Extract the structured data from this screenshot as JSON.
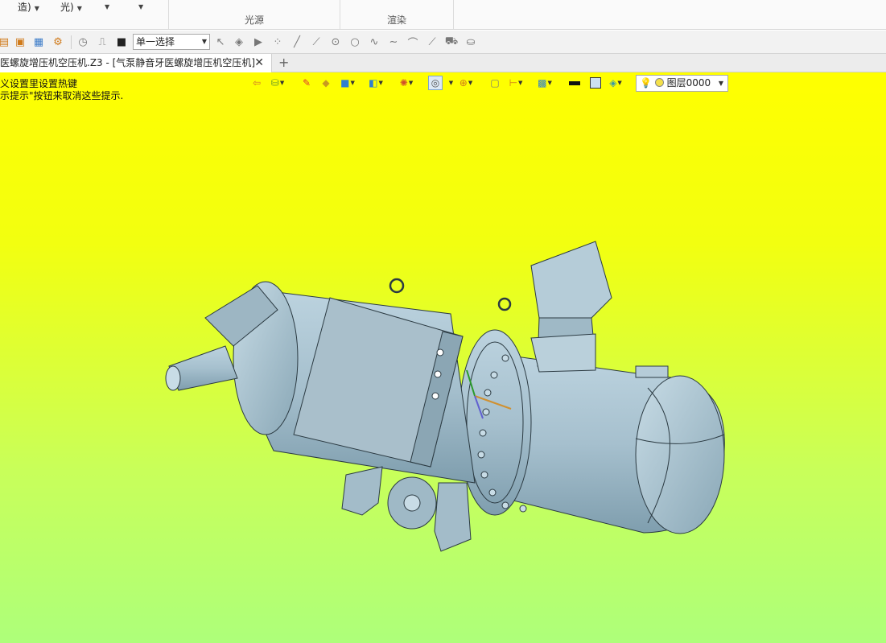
{
  "ribbon": {
    "dropdown1_label": "造)",
    "dropdown2_label": "光)",
    "group_light_label": "光源",
    "group_render_label": "渲染"
  },
  "toolbar": {
    "select_mode_value": "单一选择"
  },
  "tabs": {
    "document_tab_label": "医螺旋增压机空压机.Z3 - [气泵静音牙医螺旋增压机空压机]",
    "close_glyph": "✕",
    "add_glyph": "+"
  },
  "viewport": {
    "hint_line1": "义设置里设置热键",
    "hint_line2": "示提示\"按钮来取消这些提示.",
    "layer_value": "图层0000",
    "background_top_color": "#ffff00",
    "background_bottom_color": "#adff7a",
    "model_color": "#a9c3d1"
  },
  "icons": {
    "toolbar": [
      "new-file-icon",
      "open-icon",
      "save-icon",
      "settings-icon",
      "history-icon",
      "redo-icon",
      "stop-icon"
    ],
    "view_toolbar": [
      "exit-icon",
      "filter-icon",
      "eraser-icon",
      "cube-icon",
      "shaded-cube-icon",
      "view-icon",
      "sphere-icon",
      "display-mode-icon",
      "snap-icon",
      "frame-icon",
      "dimension-icon",
      "display-filter-icon",
      "black-line-icon",
      "color-swatch-icon",
      "layer-stack-icon",
      "bulb-icon"
    ]
  }
}
